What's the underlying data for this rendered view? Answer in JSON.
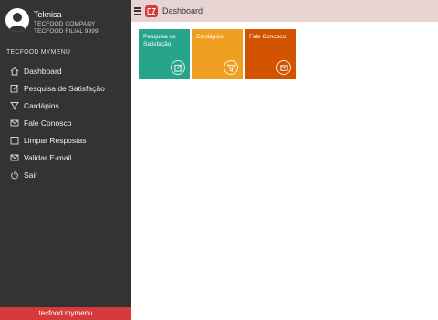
{
  "user": {
    "name": "Teknisa",
    "company": "TECFOOD COMPANY",
    "branch": "TECFOOD FILIAL 9999"
  },
  "sidebar": {
    "header": "TECFOOD MYMENU",
    "items": [
      {
        "label": "Dashboard",
        "icon": "home-icon"
      },
      {
        "label": "Pesquisa de Satisfação",
        "icon": "edit-icon"
      },
      {
        "label": "Cardápios",
        "icon": "filter-icon"
      },
      {
        "label": "Fale Conosco",
        "icon": "envelope-icon"
      },
      {
        "label": "Limpar Respostas",
        "icon": "window-icon"
      },
      {
        "label": "Validar E-mail",
        "icon": "envelope-icon"
      },
      {
        "label": "Sair",
        "icon": "power-icon"
      }
    ],
    "footer": "tecfood mymenu"
  },
  "header": {
    "title": "Dashboard"
  },
  "tiles": [
    {
      "label": "Pesquisa de Satisfação",
      "color": "#26a58c",
      "icon": "edit-icon"
    },
    {
      "label": "Cardápios",
      "color": "#f0a020",
      "icon": "filter-icon"
    },
    {
      "label": "Fale Conosco",
      "color": "#d35400",
      "icon": "envelope-icon"
    }
  ],
  "colors": {
    "sidebar_bg": "#333333",
    "topbar_bg": "#e8d3d3",
    "brand_red": "#d63a3a"
  }
}
